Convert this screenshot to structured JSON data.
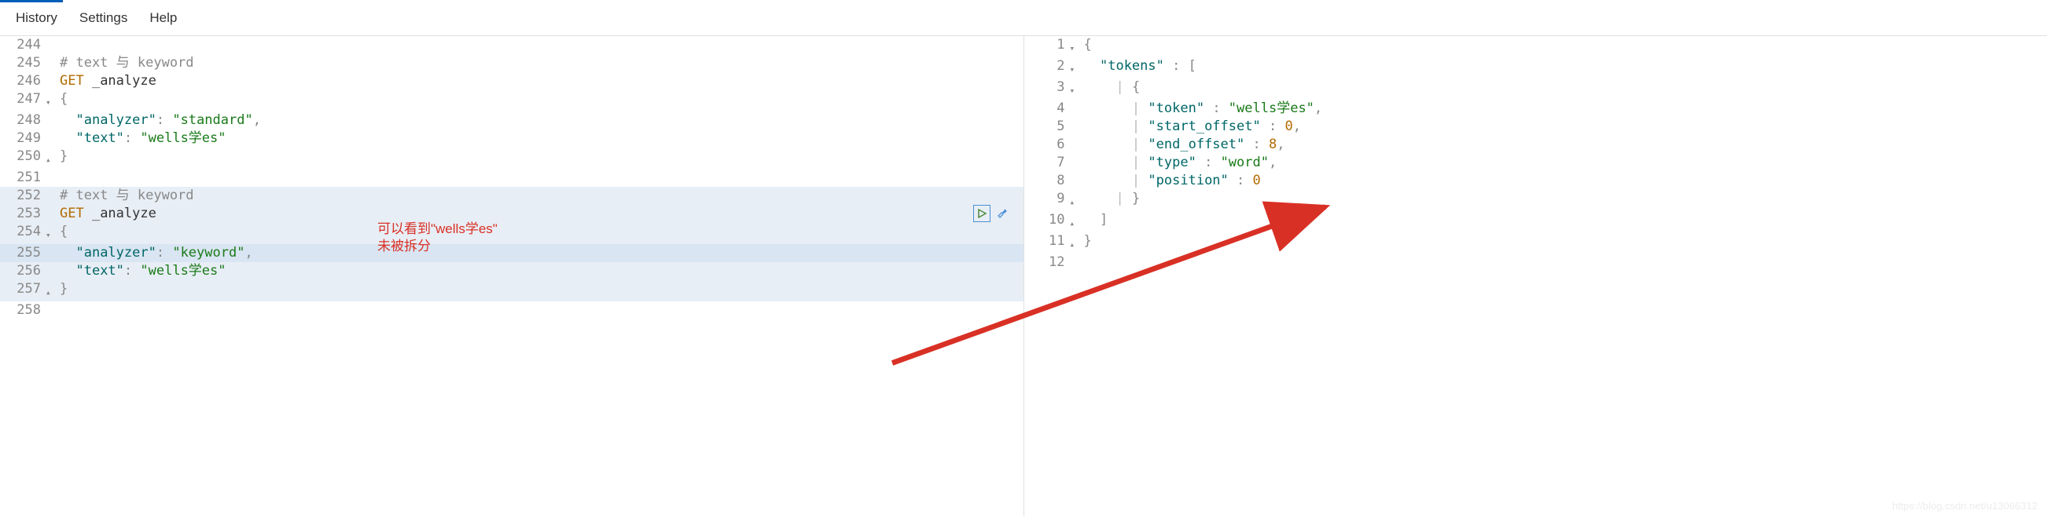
{
  "menu": {
    "history": "History",
    "settings": "Settings",
    "help": "Help"
  },
  "left_editor": {
    "lines": {
      "l244": {
        "num": "244",
        "fold": "",
        "comment": ""
      },
      "l245": {
        "num": "245",
        "fold": "",
        "comment": "# text 与 keyword"
      },
      "l246": {
        "num": "246",
        "fold": "",
        "method": "GET",
        "path": " _analyze"
      },
      "l247": {
        "num": "247",
        "fold": "▾",
        "open": "{"
      },
      "l248": {
        "num": "248",
        "fold": "",
        "indent": "  ",
        "key": "\"analyzer\"",
        "colon": ": ",
        "val": "\"standard\"",
        "trail": ","
      },
      "l249": {
        "num": "249",
        "fold": "",
        "indent": "  ",
        "key": "\"text\"",
        "colon": ": ",
        "val": "\"wells学es\""
      },
      "l250": {
        "num": "250",
        "fold": "▴",
        "close": "}"
      },
      "l251": {
        "num": "251",
        "fold": ""
      },
      "l252": {
        "num": "252",
        "fold": "",
        "comment": "# text 与 keyword"
      },
      "l253": {
        "num": "253",
        "fold": "",
        "method": "GET",
        "path": " _analyze"
      },
      "l254": {
        "num": "254",
        "fold": "▾",
        "open": "{"
      },
      "l255": {
        "num": "255",
        "fold": "",
        "indent": "  ",
        "key": "\"analyzer\"",
        "colon": ": ",
        "val": "\"keyword\"",
        "trail": ","
      },
      "l256": {
        "num": "256",
        "fold": "",
        "indent": "  ",
        "key": "\"text\"",
        "colon": ": ",
        "val": "\"wells学es\""
      },
      "l257": {
        "num": "257",
        "fold": "▴",
        "close": "}"
      },
      "l258": {
        "num": "258",
        "fold": ""
      }
    }
  },
  "right_editor": {
    "lines": {
      "r1": {
        "num": "1",
        "fold": "▾",
        "open": "{"
      },
      "r2": {
        "num": "2",
        "fold": "▾",
        "indent": "  ",
        "key": "\"tokens\"",
        "colon": " : ",
        "open": "["
      },
      "r3": {
        "num": "3",
        "fold": "▾",
        "indent": "    ",
        "pipe": "|",
        "open": "{"
      },
      "r4": {
        "num": "4",
        "fold": "",
        "indent": "      ",
        "pipe": "|",
        "key": "\"token\"",
        "colon": " : ",
        "val": "\"wells学es\"",
        "trail": ","
      },
      "r5": {
        "num": "5",
        "fold": "",
        "indent": "      ",
        "pipe": "|",
        "key": "\"start_offset\"",
        "colon": " : ",
        "num_val": "0",
        "trail": ","
      },
      "r6": {
        "num": "6",
        "fold": "",
        "indent": "      ",
        "pipe": "|",
        "key": "\"end_offset\"",
        "colon": " : ",
        "num_val": "8",
        "trail": ","
      },
      "r7": {
        "num": "7",
        "fold": "",
        "indent": "      ",
        "pipe": "|",
        "key": "\"type\"",
        "colon": " : ",
        "val": "\"word\"",
        "trail": ","
      },
      "r8": {
        "num": "8",
        "fold": "",
        "indent": "      ",
        "pipe": "|",
        "key": "\"position\"",
        "colon": " : ",
        "num_val": "0"
      },
      "r9": {
        "num": "9",
        "fold": "▴",
        "indent": "    ",
        "pipe": "|",
        "close": "}"
      },
      "r10": {
        "num": "10",
        "fold": "▴",
        "indent": "  ",
        "close": "]"
      },
      "r11": {
        "num": "11",
        "fold": "▴",
        "close": "}"
      },
      "r12": {
        "num": "12",
        "fold": ""
      }
    }
  },
  "annotation": {
    "line1": "可以看到\"wells学es\"",
    "line2": "未被拆分"
  },
  "watermark": "https://blog.csdn.net/u13066312",
  "colors": {
    "arrow": "#d93025"
  }
}
